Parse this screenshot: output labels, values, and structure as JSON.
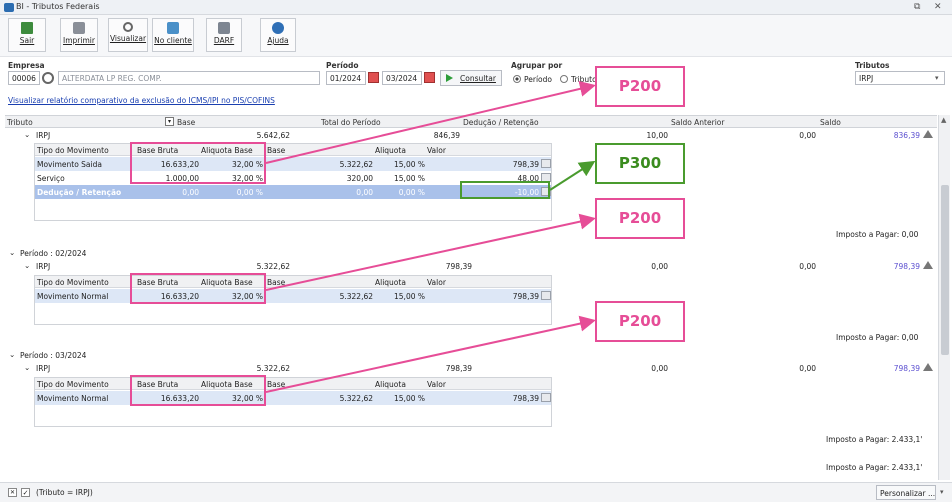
{
  "window": {
    "title": "BI - Tributos Federais"
  },
  "toolbar": [
    {
      "label": "Sair"
    },
    {
      "label": "Imprimir"
    },
    {
      "label": "Visualizar"
    },
    {
      "label": "No cliente"
    },
    {
      "label": "DARF"
    },
    {
      "label": "Ajuda"
    }
  ],
  "filters": {
    "empresa_label": "Empresa",
    "empresa_code": "00006",
    "empresa_name": "ALTERDATA LP REG. COMP.",
    "periodo_label": "Período",
    "periodo_from": "01/2024",
    "periodo_to": "03/2024",
    "consultar": "Consultar",
    "agrupar_label": "Agrupar por",
    "agrupar_periodo": "Período",
    "agrupar_tributo": "Tributo",
    "tributos_label": "Tributos",
    "tributos_value": "IRPJ"
  },
  "link": "Visualizar relatório comparativo da exclusão do ICMS/IPI no PIS/COFINS",
  "grid_headers": [
    "Tributo",
    "Base",
    "Total do Período",
    "Dedução / Retenção",
    "Saldo Anterior",
    "Saldo"
  ],
  "sub_headers": [
    "Tipo do Movimento",
    "Base Bruta",
    "Aliquota Base",
    "Base",
    "Aliquota",
    "Valor"
  ],
  "group1": {
    "tributo": "IRPJ",
    "base": "5.642,62",
    "total": "846,39",
    "saldo_anterior": "10,00",
    "deducao": "0,00",
    "saldo": "836,39",
    "rows": [
      [
        "Movimento Saida",
        "16.633,20",
        "32,00 %",
        "5.322,62",
        "15,00 %",
        "798,39"
      ],
      [
        "Serviço",
        "1.000,00",
        "32,00 %",
        "320,00",
        "15,00 %",
        "48,00"
      ],
      [
        "Dedução / Retenção",
        "0,00",
        "0,00 %",
        "0,00",
        "0,00 %",
        "-10,00"
      ]
    ],
    "imposto": "Imposto a Pagar: 0,00"
  },
  "group2": {
    "periodo": "Período : 02/2024",
    "tributo": "IRPJ",
    "base": "5.322,62",
    "total": "798,39",
    "deducao": "0,00",
    "saldo_anterior": "0,00",
    "saldo": "798,39",
    "rows": [
      [
        "Movimento Normal",
        "16.633,20",
        "32,00 %",
        "5.322,62",
        "15,00 %",
        "798,39"
      ]
    ],
    "imposto": "Imposto a Pagar: 0,00"
  },
  "group3": {
    "periodo": "Período : 03/2024",
    "tributo": "IRPJ",
    "base": "5.322,62",
    "total": "798,39",
    "deducao": "0,00",
    "saldo_anterior": "0,00",
    "saldo": "798,39",
    "rows": [
      [
        "Movimento Normal",
        "16.633,20",
        "32,00 %",
        "5.322,62",
        "15,00 %",
        "798,39"
      ]
    ],
    "imposto": "Imposto a Pagar: 2.433,1'",
    "imposto_total": "Imposto a Pagar: 2.433,1'"
  },
  "footer": {
    "filter": "(Tributo = IRPJ)",
    "personalizar": "Personalizar ..."
  },
  "callouts": [
    "P200",
    "P300",
    "P200",
    "P200"
  ],
  "colors": {
    "pink": "#e64d97",
    "green": "#4a9b2e",
    "selected_row": "#dde7f6",
    "deduction_row": "#a9c1ea"
  }
}
